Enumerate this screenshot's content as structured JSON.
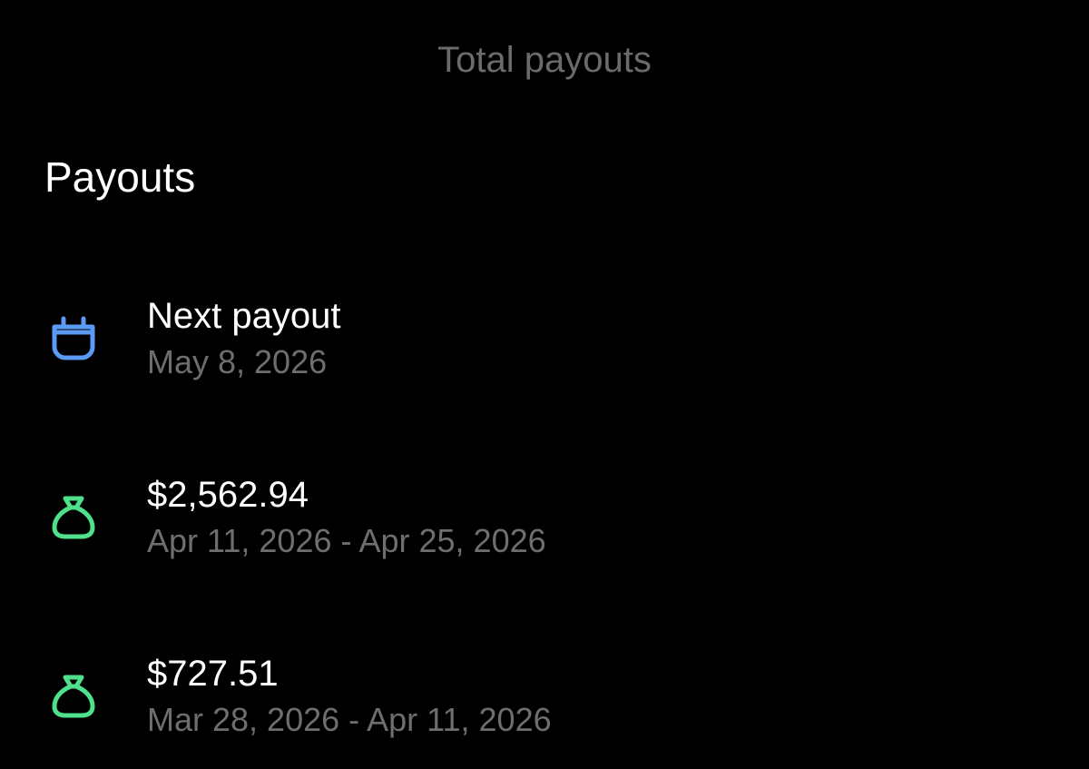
{
  "header": {
    "total_payouts_label": "Total payouts"
  },
  "section": {
    "title": "Payouts"
  },
  "colors": {
    "calendar_icon": "#5b9bf5",
    "money_bag_icon": "#4ee08a",
    "secondary_text": "#6e6e6e"
  },
  "next_payout": {
    "icon": "calendar-icon",
    "title": "Next payout",
    "date": "May 8, 2026"
  },
  "payouts": [
    {
      "icon": "money-bag-icon",
      "amount": "$2,562.94",
      "period": "Apr 11, 2026 - Apr 25, 2026"
    },
    {
      "icon": "money-bag-icon",
      "amount": "$727.51",
      "period": "Mar 28, 2026 - Apr 11, 2026"
    }
  ]
}
